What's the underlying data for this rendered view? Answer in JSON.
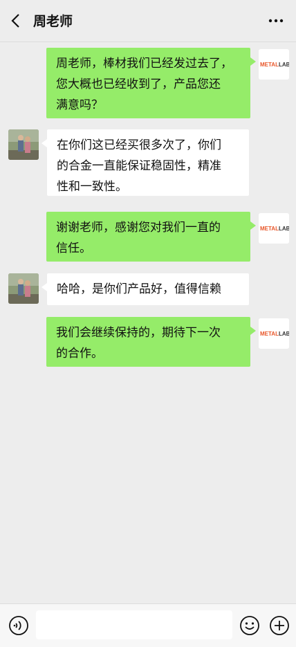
{
  "header": {
    "title": "周老师",
    "back_icon": "chevron-left-icon",
    "more_icon": "more-dots-icon"
  },
  "logo": {
    "text_orange": "METAL",
    "text_dark": "LAB"
  },
  "messages": [
    {
      "sender": "me",
      "text": "周老师，棒材我们已经发过去了，\n您大概也已经收到了，产品您还\n满意吗？"
    },
    {
      "sender": "them",
      "text": "在你们这已经买很多次了，你们\n的合金一直能保证稳固性，精准\n性和一致性。"
    },
    {
      "sender": "me",
      "text": "谢谢老师，感谢您对我们一直的\n信任。"
    },
    {
      "sender": "them",
      "text": "哈哈，是你们产品好，值得信赖"
    },
    {
      "sender": "me",
      "text": "我们会继续保持的，期待下一次\n的合作。"
    }
  ],
  "input_bar": {
    "voice_icon": "voice-icon",
    "input_placeholder": "",
    "emoji_icon": "emoji-icon",
    "plus_icon": "plus-icon"
  },
  "colors": {
    "background": "#ededed",
    "my_bubble": "#95ec69",
    "their_bubble": "#ffffff",
    "logo_orange": "#e8572a"
  }
}
